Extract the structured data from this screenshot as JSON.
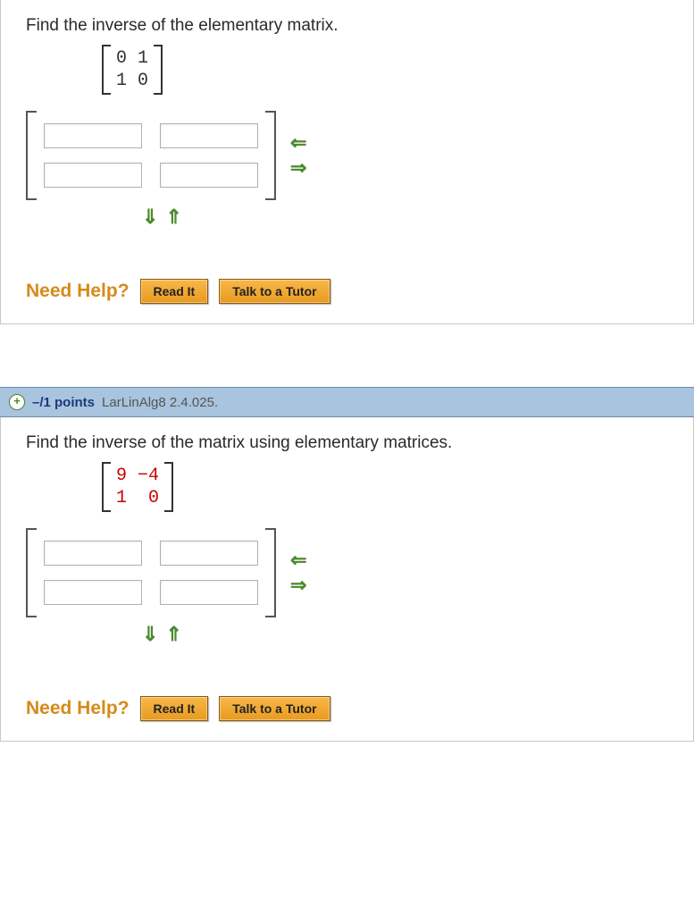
{
  "q1": {
    "prompt": "Find the inverse of the elementary matrix.",
    "matrix_row1": "0 1",
    "matrix_row2": "1 0",
    "need_help": "Need Help?",
    "read_it": "Read It",
    "tutor": "Talk to a Tutor"
  },
  "header": {
    "expand": "+",
    "points": "–/1 points",
    "source": "LarLinAlg8 2.4.025."
  },
  "q2": {
    "prompt": "Find the inverse of the matrix using elementary matrices.",
    "m11": "9",
    "m12": "−4",
    "m21": "1",
    "m22": "0",
    "need_help": "Need Help?",
    "read_it": "Read It",
    "tutor": "Talk to a Tutor"
  },
  "arrows": {
    "left": "⇐",
    "right": "⇒",
    "down": "⇓",
    "up": "⇑"
  }
}
